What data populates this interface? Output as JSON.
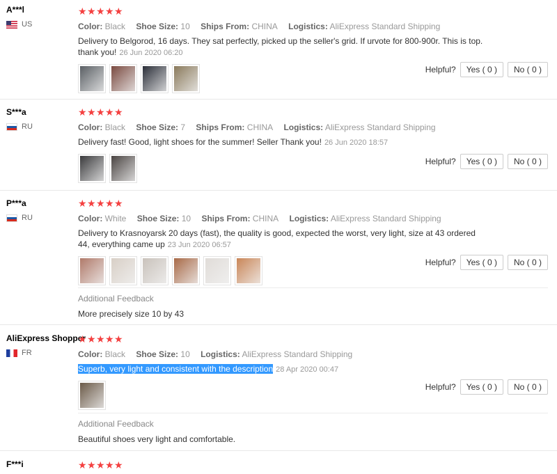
{
  "labels": {
    "color": "Color:",
    "shoe_size": "Shoe Size:",
    "ships_from": "Ships From:",
    "logistics": "Logistics:",
    "helpful": "Helpful?",
    "yes": "Yes ( 0 )",
    "no": "No ( 0 )",
    "additional_feedback": "Additional Feedback"
  },
  "reviews": [
    {
      "user": "A***l",
      "country": "US",
      "stars": 5,
      "color": "Black",
      "shoe_size": "10",
      "ships_from": "CHINA",
      "logistics": "AliExpress Standard Shipping",
      "text": "Delivery to Belgorod, 16 days. They sat perfectly, picked up the seller's grid. If urvote for 800-900r. This is top. thank you!",
      "date": "26 Jun 2020 06:20",
      "photos": [
        "#5a5f64",
        "#7a4a40",
        "#2a2e38",
        "#8a7a5c"
      ]
    },
    {
      "user": "S***a",
      "country": "RU",
      "stars": 5,
      "color": "Black",
      "shoe_size": "7",
      "ships_from": "CHINA",
      "logistics": "AliExpress Standard Shipping",
      "text": "Delivery fast! Good, light shoes for the summer! Seller Thank you!",
      "date": "26 Jun 2020 18:57",
      "photos": [
        "#3a3a3c",
        "#4a4442"
      ]
    },
    {
      "user": "P***a",
      "country": "RU",
      "stars": 5,
      "color": "White",
      "shoe_size": "10",
      "ships_from": "CHINA",
      "logistics": "AliExpress Standard Shipping",
      "text": "Delivery to Krasnoyarsk 20 days (fast), the quality is good, expected the worst, very light, size at 43 ordered 44, everything came up",
      "date": "23 Jun 2020 06:57",
      "photos": [
        "#b07a6a",
        "#d8cfc6",
        "#c9c2bb",
        "#a86a48",
        "#e0dcd8",
        "#c98658"
      ],
      "additional_feedback": "More precisely size 10 by 43"
    },
    {
      "user": "AliExpress Shopper",
      "country": "FR",
      "stars": 5,
      "color": "Black",
      "shoe_size": "10",
      "logistics": "AliExpress Standard Shipping",
      "text": "Superb, very light and consistent with the description",
      "date": "28 Apr 2020 00:47",
      "photos": [
        "#6b5a48"
      ],
      "additional_feedback": "Beautiful shoes very light and comfortable."
    },
    {
      "user": "F***i",
      "stars": 5
    }
  ]
}
